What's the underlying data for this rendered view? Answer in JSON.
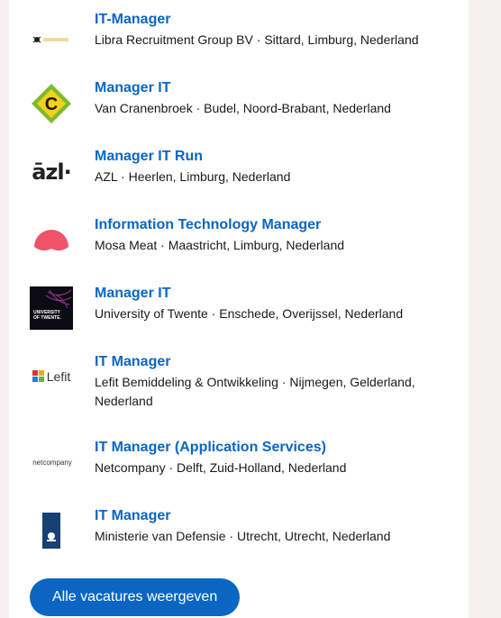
{
  "jobs": [
    {
      "title": "IT-Manager",
      "company": "Libra Recruitment Group BV",
      "location": "Sittard, Limburg, Nederland",
      "logo": "libra-logo",
      "logo_text": "Libra recruitment group"
    },
    {
      "title": "Manager IT",
      "company": "Van Cranenbroek",
      "location": "Budel, Noord-Brabant, Nederland",
      "logo": "van-cranenbroek-logo",
      "logo_text": "C"
    },
    {
      "title": "Manager IT Run",
      "company": "AZL",
      "location": "Heerlen, Limburg, Nederland",
      "logo": "azl-logo",
      "logo_text": "āzl·"
    },
    {
      "title": "Information Technology Manager",
      "company": "Mosa Meat",
      "location": "Maastricht, Limburg, Nederland",
      "logo": "mosa-meat-logo",
      "logo_text": ""
    },
    {
      "title": "Manager IT",
      "company": "University of Twente",
      "location": "Enschede, Overijssel, Nederland",
      "logo": "university-of-twente-logo",
      "logo_text": "UNIVERSITY OF TWENTE."
    },
    {
      "title": "IT Manager",
      "company": "Lefit Bemiddeling & Ontwikkeling",
      "location": "Nijmegen, Gelderland, Nederland",
      "logo": "lefit-logo",
      "logo_text": "Lefit"
    },
    {
      "title": "IT Manager (Application Services)",
      "company": "Netcompany",
      "location": "Delft, Zuid-Holland, Nederland",
      "logo": "netcompany-logo",
      "logo_text": "netcompany"
    },
    {
      "title": "IT Manager",
      "company": "Ministerie van Defensie",
      "location": "Utrecht, Utrecht, Nederland",
      "logo": "defensie-logo",
      "logo_text": ""
    }
  ],
  "separator": " · ",
  "footer": {
    "all_jobs_label": "Alle vacatures weergeven"
  },
  "colors": {
    "link": "#0a66c2",
    "button": "#0a66c2",
    "panel": "#ffffff",
    "page": "#f3f2ef"
  }
}
